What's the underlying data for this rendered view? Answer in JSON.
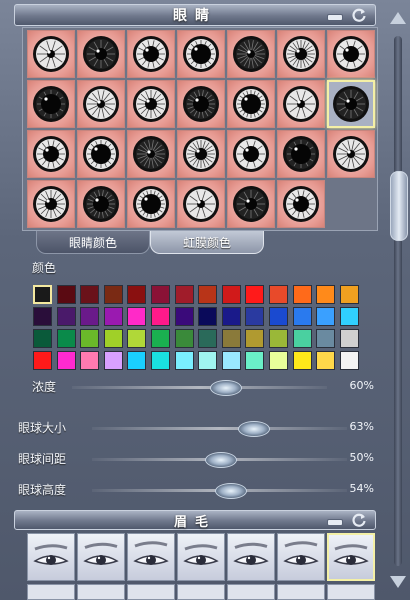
{
  "eyes_panel": {
    "title": "眼睛"
  },
  "eye_styles": [
    "dark-iris",
    "black-pupil",
    "spiked-iris",
    "heart-pupil",
    "pale-iris",
    "star-burst",
    "crater-iris",
    "ringed-iris",
    "radial-iris",
    "target-iris",
    "slit-pupil",
    "large-pupil",
    "dark-ring",
    "mirror-pupil",
    "flower-iris",
    "pale-ring",
    "dark-disc",
    "shattered-iris",
    "cracked-iris",
    "blank-star",
    "star-pupil",
    "triskelion",
    "snowflake-iris",
    "glossy-pupil",
    "swirl-iris",
    "spiral-iris",
    "grey-cog"
  ],
  "tabs": {
    "eye_color": "眼睛颜色",
    "iris_color": "虹膜颜色"
  },
  "color_section": {
    "label": "颜色",
    "swatches": [
      "#1a1a1a",
      "#5a0a12",
      "#6a121a",
      "#7a2a14",
      "#8a1010",
      "#8a1236",
      "#a01c2a",
      "#b83418",
      "#d11a1a",
      "#ff1a1a",
      "#e84a2a",
      "#ff6a1a",
      "#ff8a1a",
      "#f0a020",
      "#2a0e3a",
      "#4a1a6a",
      "#6a1a8a",
      "#9a1ab0",
      "#ff2ac8",
      "#ff1a8a",
      "#3a0a7a",
      "#0a0a5a",
      "#1a1a8a",
      "#2a3aa0",
      "#1a4ad0",
      "#2a7aee",
      "#3aa0ff",
      "#30d0ff",
      "#0a5a3a",
      "#0a8a4a",
      "#6ab82a",
      "#a0d028",
      "#b0d838",
      "#1ab050",
      "#3a8a3a",
      "#2a6a5a",
      "#8a7a3a",
      "#b09a30",
      "#9ab838",
      "#4ad0a0",
      "#6a8aa0",
      "#d0d0d0",
      "#ff1a1a",
      "#ff2ad0",
      "#ff7ab0",
      "#d8a0ff",
      "#1ad0ff",
      "#1ae0e0",
      "#7aefff",
      "#a0f4f0",
      "#9ae8ff",
      "#6af0c8",
      "#e8ff9a",
      "#ffe81a",
      "#ffd84a",
      "#f4f4f4"
    ],
    "selected_index": 0
  },
  "sliders": [
    {
      "label": "浓度",
      "value_text": "60%",
      "value": 0.6
    },
    {
      "label": "眼球大小",
      "value_text": "63%",
      "value": 0.63
    },
    {
      "label": "眼球间距",
      "value_text": "50%",
      "value": 0.5
    },
    {
      "label": "眼球高度",
      "value_text": "54%",
      "value": 0.54
    }
  ],
  "brow_panel": {
    "title": "眉毛"
  },
  "brow_styles": [
    "brow-1",
    "brow-2",
    "brow-3",
    "brow-4",
    "brow-5",
    "brow-6",
    "brow-7"
  ],
  "selected_eye_index": 13,
  "selected_brow_index": 6
}
